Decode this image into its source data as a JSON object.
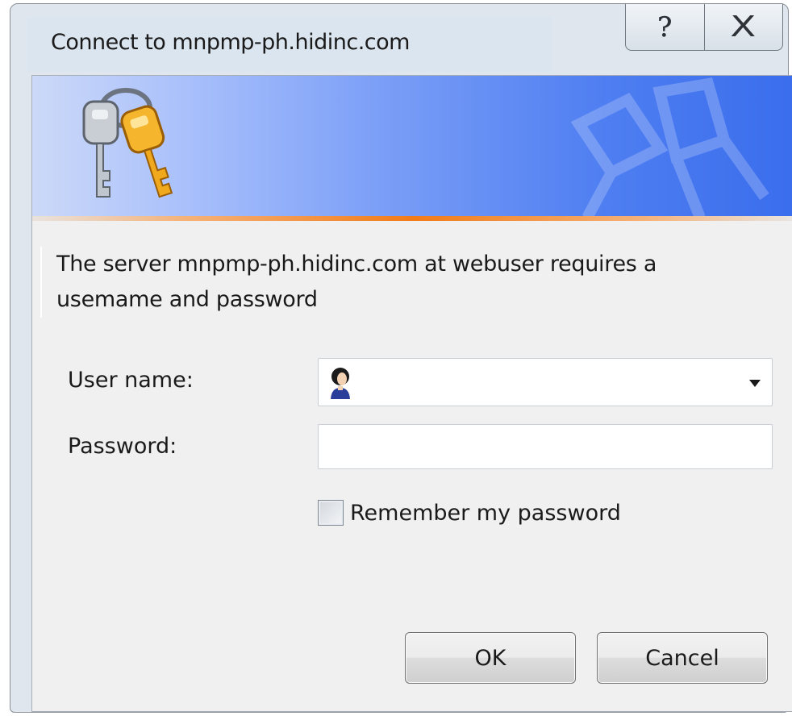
{
  "window": {
    "title": "Connect to mnpmp-ph.hidinc.com",
    "help_glyph": "?",
    "close_glyph": "X"
  },
  "dialog": {
    "message": "The server mnpmp-ph.hidinc.com at webuser requires a usemame and password",
    "username_label": "User name:",
    "username_value": "",
    "password_label": "Password:",
    "password_value": "",
    "remember_label": "Remember my password",
    "remember_checked": false,
    "ok_label": "OK",
    "cancel_label": "Cancel"
  },
  "colors": {
    "banner_start": "#ccd9f8",
    "banner_end": "#3a6ded",
    "accent_line": "#f27b18"
  },
  "icons": {
    "banner": "keys-icon",
    "username": "user-avatar-icon",
    "dropdown": "chevron-down-icon"
  }
}
